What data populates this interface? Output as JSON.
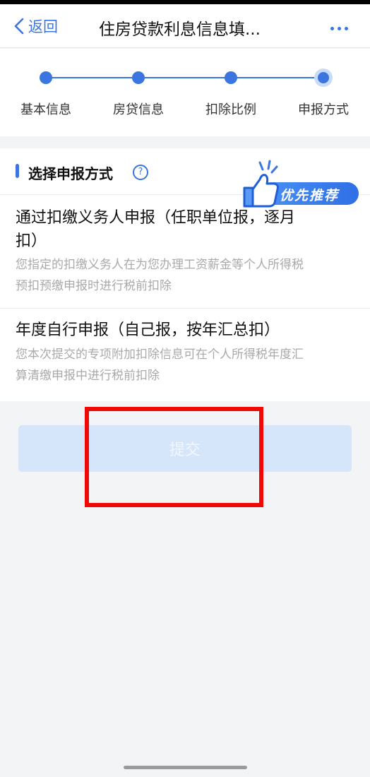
{
  "navbar": {
    "back_label": "返回",
    "title": "住房贷款利息信息填...",
    "accent": "#3a75e0"
  },
  "steps": [
    {
      "label": "基本信息",
      "status": "done"
    },
    {
      "label": "房贷信息",
      "status": "done"
    },
    {
      "label": "扣除比例",
      "status": "done"
    },
    {
      "label": "申报方式",
      "status": "current"
    }
  ],
  "section": {
    "title": "选择申报方式",
    "help_icon": "question-circle-icon",
    "badge": "优先推荐",
    "badge_icon": "thumbs-up-icon"
  },
  "options": [
    {
      "title": "通过扣缴义务人申报（任职单位报，逐月扣）",
      "desc": "您指定的扣缴义务人在为您办理工资薪金等个人所得税预扣预缴申报时进行税前扣除"
    },
    {
      "title": "年度自行申报（自己报，按年汇总扣）",
      "desc": "您本次提交的专项附加扣除信息可在个人所得税年度汇算清缴申报中进行税前扣除"
    }
  ],
  "submit": {
    "label": "提交",
    "state": "disabled"
  },
  "annotation_color": "#f00805"
}
